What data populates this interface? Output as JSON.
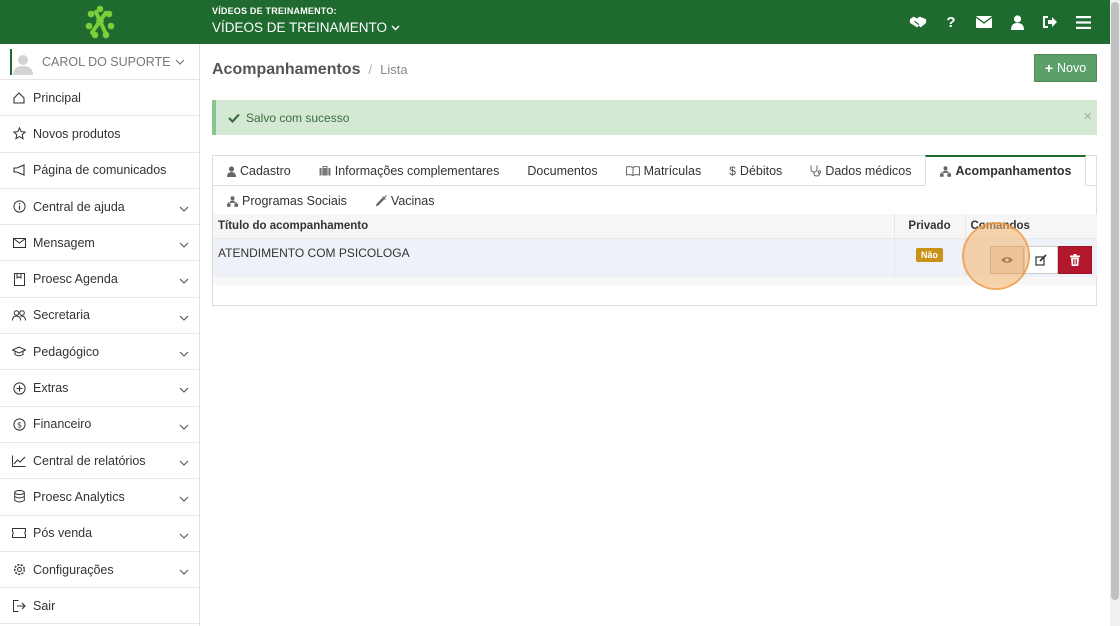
{
  "header": {
    "school_label": "VÍDEOS DE TREINAMENTO:",
    "school_name": "VÍDEOS DE TREINAMENTO",
    "icons": [
      "handshake-icon",
      "help-icon",
      "mail-icon",
      "user-icon",
      "logout-icon",
      "menu-icon"
    ]
  },
  "sidebar": {
    "user": "CAROL DO SUPORTE",
    "items": [
      {
        "label": "Principal",
        "icon": "home-icon",
        "has_children": false
      },
      {
        "label": "Novos produtos",
        "icon": "star-icon",
        "has_children": false
      },
      {
        "label": "Página de comunicados",
        "icon": "megaphone-icon",
        "has_children": false
      },
      {
        "label": "Central de ajuda",
        "icon": "info-icon",
        "has_children": true
      },
      {
        "label": "Mensagem",
        "icon": "envelope-icon",
        "has_children": true
      },
      {
        "label": "Proesc Agenda",
        "icon": "agenda-icon",
        "has_children": true
      },
      {
        "label": "Secretaria",
        "icon": "people-icon",
        "has_children": true
      },
      {
        "label": "Pedagógico",
        "icon": "graduation-icon",
        "has_children": true
      },
      {
        "label": "Extras",
        "icon": "plus-circle-icon",
        "has_children": true
      },
      {
        "label": "Financeiro",
        "icon": "money-icon",
        "has_children": true
      },
      {
        "label": "Central de relatórios",
        "icon": "chart-icon",
        "has_children": true
      },
      {
        "label": "Proesc Analytics",
        "icon": "database-icon",
        "has_children": true
      },
      {
        "label": "Pós venda",
        "icon": "ticket-icon",
        "has_children": true
      },
      {
        "label": "Configurações",
        "icon": "gear-icon",
        "has_children": true
      },
      {
        "label": "Sair",
        "icon": "exit-icon",
        "has_children": false
      }
    ]
  },
  "page": {
    "title": "Acompanhamentos",
    "breadcrumb": "Lista",
    "new_button": "Novo",
    "alert": "Salvo com sucesso",
    "alert_close": "×"
  },
  "tabs": [
    {
      "label": "Cadastro",
      "icon": "user-icon"
    },
    {
      "label": "Informações complementares",
      "icon": "briefcase-icon"
    },
    {
      "label": "Documentos",
      "icon": ""
    },
    {
      "label": "Matrículas",
      "icon": "book-icon"
    },
    {
      "label": "Débitos",
      "icon": "dollar-icon"
    },
    {
      "label": "Dados médicos",
      "icon": "stethoscope-icon"
    },
    {
      "label": "Acompanhamentos",
      "icon": "sitemap-icon",
      "active": true
    },
    {
      "label": "Programas Sociais",
      "icon": "sitemap-icon"
    },
    {
      "label": "Vacinas",
      "icon": "syringe-icon"
    }
  ],
  "table": {
    "columns": [
      "Título do acompanhamento",
      "Privado",
      "Comandos"
    ],
    "rows": [
      {
        "title": "ATENDIMENTO COM PSICOLOGA",
        "private": "Não"
      }
    ]
  },
  "colors": {
    "brand": "#1e6a2f",
    "success_button": "#5ba06a",
    "alert_bg": "#d3e9d3",
    "badge": "#c8911a",
    "delete": "#b3172c"
  }
}
